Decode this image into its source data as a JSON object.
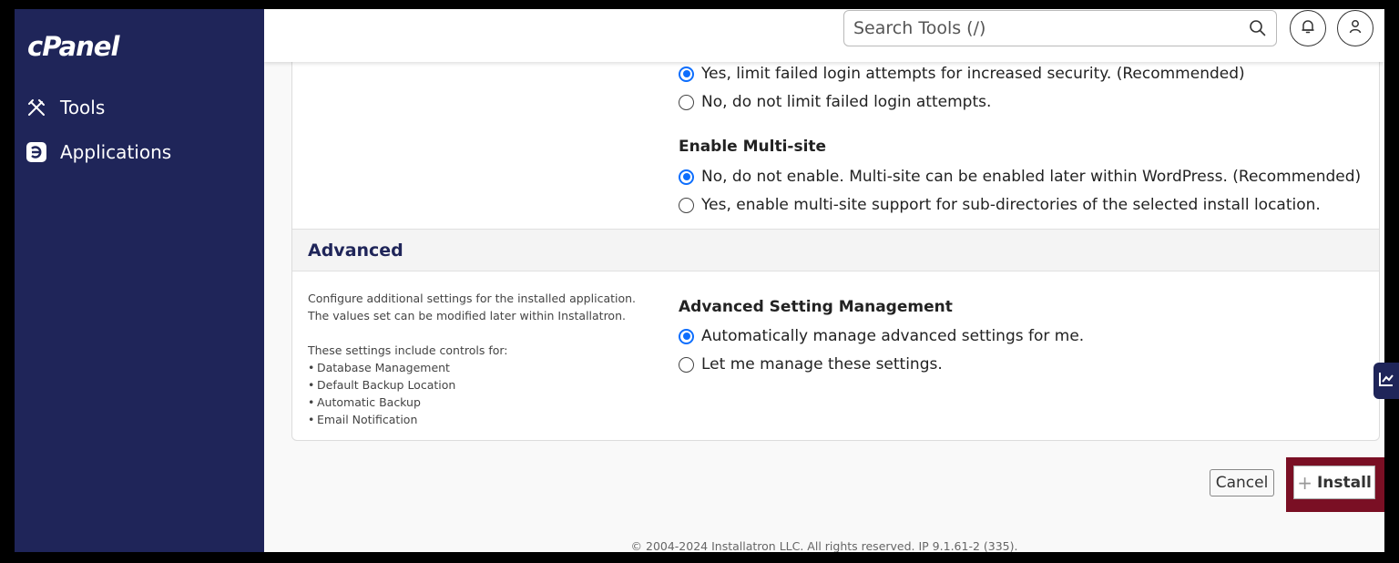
{
  "sidebar": {
    "logo": "cPanel",
    "items": [
      {
        "label": "Tools",
        "icon": "tools-icon"
      },
      {
        "label": "Applications",
        "icon": "applications-icon"
      }
    ]
  },
  "header": {
    "search_placeholder": "Search Tools (/)",
    "icons": [
      "search-icon",
      "bell-icon",
      "user-icon"
    ]
  },
  "login_limit": {
    "options": [
      {
        "label": "Yes, limit failed login attempts for increased security. (Recommended)",
        "selected": true
      },
      {
        "label": "No, do not limit failed login attempts.",
        "selected": false
      }
    ]
  },
  "multisite": {
    "title": "Enable Multi-site",
    "options": [
      {
        "label": "No, do not enable. Multi-site can be enabled later within WordPress. (Recommended)",
        "selected": true
      },
      {
        "label": "Yes, enable multi-site support for sub-directories of the selected install location.",
        "selected": false
      }
    ]
  },
  "advanced": {
    "section_title": "Advanced",
    "description_1": "Configure additional settings for the installed application.",
    "description_2": "The values set can be modified later within Installatron.",
    "description_3": "These settings include controls for:",
    "bullets": [
      "Database Management",
      "Default Backup Location",
      "Automatic Backup",
      "Email Notification"
    ],
    "setting_title": "Advanced Setting Management",
    "options": [
      {
        "label": "Automatically manage advanced settings for me.",
        "selected": true
      },
      {
        "label": "Let me manage these settings.",
        "selected": false
      }
    ]
  },
  "actions": {
    "cancel_label": "Cancel",
    "install_label": "Install"
  },
  "footer": {
    "copyright": "© 2004-2024 Installatron LLC. All rights reserved. IP 9.1.61-2 (335)."
  },
  "colors": {
    "sidebar_bg": "#1f2559",
    "accent": "#0d6efd",
    "highlight": "#7a0f24"
  }
}
